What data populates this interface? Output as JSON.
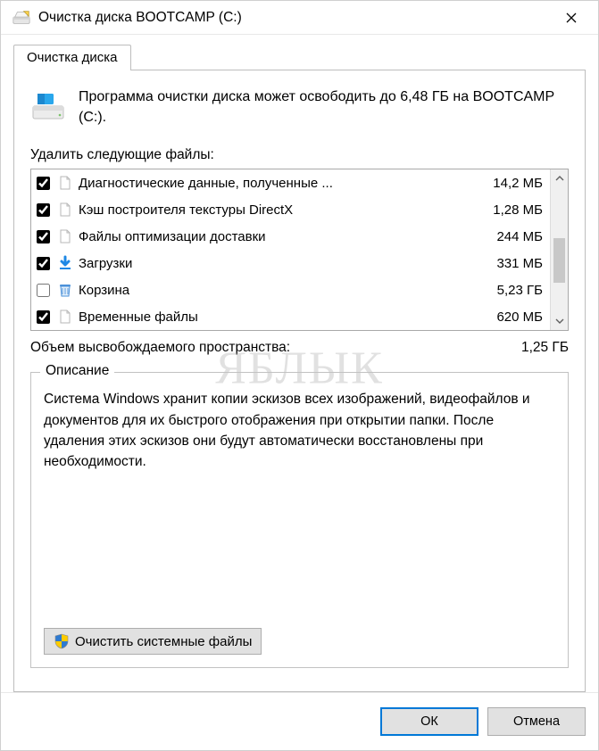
{
  "titlebar": {
    "title": "Очистка диска BOOTCAMP (C:)"
  },
  "tab": {
    "label": "Очистка диска"
  },
  "intro": {
    "text": "Программа очистки диска может освободить до 6,48 ГБ на BOOTCAMP (C:)."
  },
  "files": {
    "header": "Удалить следующие файлы:",
    "items": [
      {
        "checked": true,
        "icon": "file",
        "name": "Диагностические данные, полученные ...",
        "size": "14,2 МБ"
      },
      {
        "checked": true,
        "icon": "file",
        "name": "Кэш построителя текстуры DirectX",
        "size": "1,28 МБ"
      },
      {
        "checked": true,
        "icon": "file",
        "name": "Файлы оптимизации доставки",
        "size": "244 МБ"
      },
      {
        "checked": true,
        "icon": "download",
        "name": "Загрузки",
        "size": "331 МБ"
      },
      {
        "checked": false,
        "icon": "bin",
        "name": "Корзина",
        "size": "5,23 ГБ"
      },
      {
        "checked": true,
        "icon": "file",
        "name": "Временные файлы",
        "size": "620 МБ"
      }
    ]
  },
  "summary": {
    "label": "Объем высвобождаемого пространства:",
    "value": "1,25 ГБ"
  },
  "description": {
    "legend": "Описание",
    "text": "Система Windows хранит копии эскизов всех изображений, видеофайлов и документов для их быстрого отображения при открытии папки. После удаления этих эскизов они будут автоматически восстановлены при необходимости."
  },
  "buttons": {
    "cleanup_system": "Очистить системные файлы",
    "ok": "ОК",
    "cancel": "Отмена"
  },
  "watermark": "ЯБЛЫК"
}
